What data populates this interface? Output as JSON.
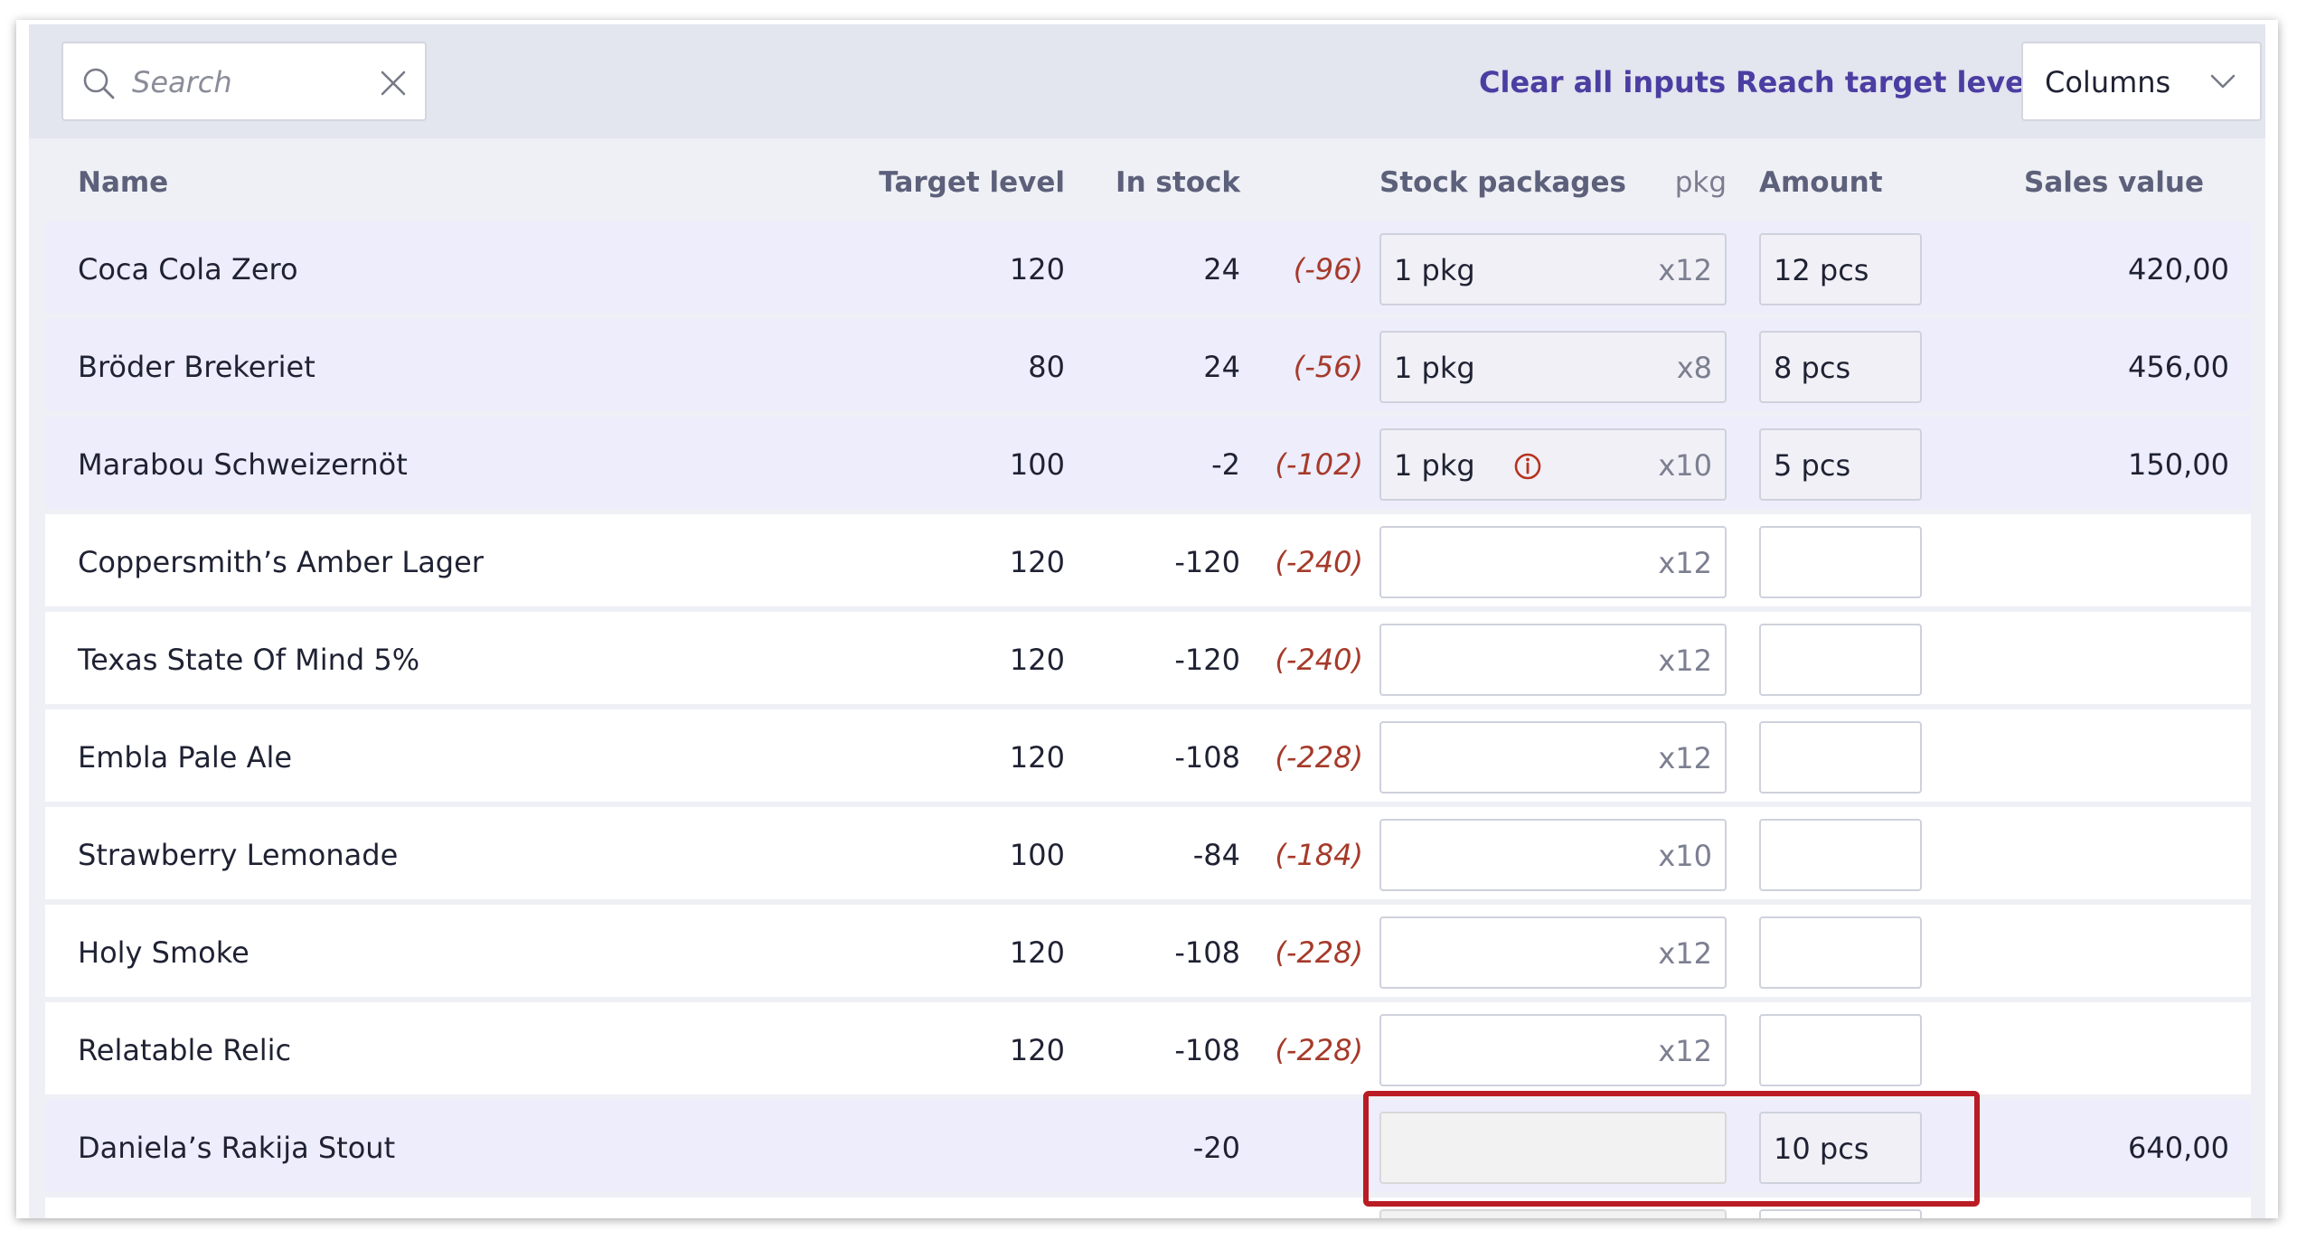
{
  "toolbar": {
    "search_placeholder": "Search",
    "clear_all_label": "Clear all inputs",
    "reach_target_label": "Reach target level",
    "columns_label": "Columns"
  },
  "columns": {
    "name": "Name",
    "target_level": "Target level",
    "in_stock": "In stock",
    "stock_packages": "Stock packages",
    "pkg_unit": "pkg",
    "amount": "Amount",
    "sales_value": "Sales value"
  },
  "rows": [
    {
      "name": "Coca Cola Zero",
      "target": "120",
      "stock": "24",
      "diff": "(-96)",
      "pkg": "1 pkg",
      "mult": "x12",
      "amount": "12 pcs",
      "sales": "420,00"
    },
    {
      "name": "Bröder Brekeriet",
      "target": "80",
      "stock": "24",
      "diff": "(-56)",
      "pkg": "1 pkg",
      "mult": "x8",
      "amount": "8 pcs",
      "sales": "456,00"
    },
    {
      "name": "Marabou Schweizernöt",
      "target": "100",
      "stock": "-2",
      "diff": "(-102)",
      "pkg": "1 pkg",
      "mult": "x10",
      "amount": "5 pcs",
      "sales": "150,00"
    },
    {
      "name": "Coppersmith’s Amber Lager",
      "target": "120",
      "stock": "-120",
      "diff": "(-240)",
      "pkg": "",
      "mult": "x12",
      "amount": "",
      "sales": ""
    },
    {
      "name": "Texas State Of Mind 5%",
      "target": "120",
      "stock": "-120",
      "diff": "(-240)",
      "pkg": "",
      "mult": "x12",
      "amount": "",
      "sales": ""
    },
    {
      "name": "Embla Pale Ale",
      "target": "120",
      "stock": "-108",
      "diff": "(-228)",
      "pkg": "",
      "mult": "x12",
      "amount": "",
      "sales": ""
    },
    {
      "name": "Strawberry Lemonade",
      "target": "100",
      "stock": "-84",
      "diff": "(-184)",
      "pkg": "",
      "mult": "x10",
      "amount": "",
      "sales": ""
    },
    {
      "name": "Holy Smoke",
      "target": "120",
      "stock": "-108",
      "diff": "(-228)",
      "pkg": "",
      "mult": "x12",
      "amount": "",
      "sales": ""
    },
    {
      "name": "Relatable Relic",
      "target": "120",
      "stock": "-108",
      "diff": "(-228)",
      "pkg": "",
      "mult": "x12",
      "amount": "",
      "sales": ""
    },
    {
      "name": "Daniela’s Rakija Stout",
      "target": "",
      "stock": "-20",
      "diff": "",
      "pkg": "",
      "mult": "",
      "amount": "10 pcs",
      "sales": "640,00"
    }
  ],
  "colors": {
    "accent": "#4b3ea2",
    "negative_diff": "#a63a2a",
    "highlight_row": "#ededfc",
    "annotation_box": "#b91c24"
  }
}
